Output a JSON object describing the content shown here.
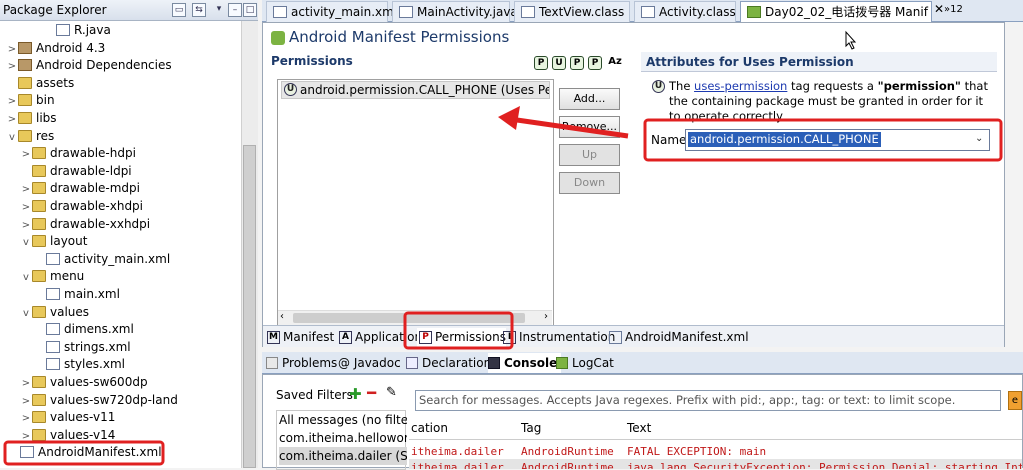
{
  "package_explorer": {
    "title": "Package Explorer",
    "items": [
      {
        "label": "R.java",
        "icon": "java-file-icon",
        "expand": ""
      },
      {
        "label": "Android 4.3",
        "icon": "library-icon",
        "expand": ">"
      },
      {
        "label": "Android Dependencies",
        "icon": "library-icon",
        "expand": ">"
      },
      {
        "label": "assets",
        "icon": "folder-icon",
        "expand": ""
      },
      {
        "label": "bin",
        "icon": "folder-icon",
        "expand": ">"
      },
      {
        "label": "libs",
        "icon": "folder-icon",
        "expand": ">"
      },
      {
        "label": "res",
        "icon": "folder-icon",
        "expand": "v"
      },
      {
        "label": "drawable-hdpi",
        "icon": "folder-icon",
        "expand": ">"
      },
      {
        "label": "drawable-ldpi",
        "icon": "folder-icon",
        "expand": ""
      },
      {
        "label": "drawable-mdpi",
        "icon": "folder-icon",
        "expand": ">"
      },
      {
        "label": "drawable-xhdpi",
        "icon": "folder-icon",
        "expand": ">"
      },
      {
        "label": "drawable-xxhdpi",
        "icon": "folder-icon",
        "expand": ">"
      },
      {
        "label": "layout",
        "icon": "folder-icon",
        "expand": "v"
      },
      {
        "label": "activity_main.xml",
        "icon": "xml-file-icon",
        "expand": ""
      },
      {
        "label": "menu",
        "icon": "folder-icon",
        "expand": "v"
      },
      {
        "label": "main.xml",
        "icon": "xml-file-icon",
        "expand": ""
      },
      {
        "label": "values",
        "icon": "folder-icon",
        "expand": "v"
      },
      {
        "label": "dimens.xml",
        "icon": "xml-file-icon",
        "expand": ""
      },
      {
        "label": "strings.xml",
        "icon": "xml-file-icon",
        "expand": ""
      },
      {
        "label": "styles.xml",
        "icon": "xml-file-icon",
        "expand": ""
      },
      {
        "label": "values-sw600dp",
        "icon": "folder-icon",
        "expand": ">"
      },
      {
        "label": "values-sw720dp-land",
        "icon": "folder-icon",
        "expand": ">"
      },
      {
        "label": "values-v11",
        "icon": "folder-icon",
        "expand": ">"
      },
      {
        "label": "values-v14",
        "icon": "folder-icon",
        "expand": ">"
      },
      {
        "label": "AndroidManifest.xml",
        "icon": "manifest-file-icon",
        "expand": ""
      }
    ]
  },
  "editor_tabs": [
    {
      "label": "activity_main.xml"
    },
    {
      "label": "MainActivity.java"
    },
    {
      "label": "TextView.class"
    },
    {
      "label": "Activity.class"
    },
    {
      "label": "Day02_02_电话拨号器 Manif"
    }
  ],
  "editor_tabs_overflow": "»12",
  "editor": {
    "title": "Android Manifest Permissions",
    "permissions_heading": "Permissions",
    "sort_icons": [
      "P",
      "U",
      "P",
      "P",
      "Az"
    ],
    "permission_item": "android.permission.CALL_PHONE (Uses Permis",
    "buttons": {
      "add": "Add...",
      "remove": "Remove...",
      "up": "Up",
      "down": "Down"
    },
    "attributes_heading": "Attributes for Uses Permission",
    "description_pre": "The ",
    "description_link": "uses-permission",
    "description_mid": " tag requests a ",
    "description_bold": "\"permission\"",
    "description_post": " that the containing package must be granted in order for it to operate correctly.",
    "name_label": "Name",
    "name_value": "android.permission.CALL_PHONE"
  },
  "bottom_tabs": [
    {
      "label": "Manifest",
      "icon": "M"
    },
    {
      "label": "Application",
      "icon": "A"
    },
    {
      "label": "Permissions",
      "icon": "P"
    },
    {
      "label": "Instrumentation",
      "icon": "I"
    },
    {
      "label": "AndroidManifest.xml",
      "icon": ""
    }
  ],
  "view_tabs": [
    {
      "label": "Problems"
    },
    {
      "label": "@ Javadoc"
    },
    {
      "label": "Declaration"
    },
    {
      "label": "Console"
    },
    {
      "label": "LogCat"
    }
  ],
  "logcat": {
    "saved_filters": "Saved Filters",
    "filters": [
      "All messages (no filters)",
      "com.itheima.helloworld",
      "com.itheima.dailer (Sess"
    ],
    "search_placeholder": "Search for messages. Accepts Java regexes. Prefix with pid:, app:, tag: or text: to limit scope.",
    "columns": [
      "cation",
      "Tag",
      "Text"
    ],
    "rows": [
      {
        "app": "itheima.dailer",
        "tag": "AndroidRuntime",
        "text": "FATAL EXCEPTION: main"
      },
      {
        "app": "itheima.dailer",
        "tag": "AndroidRuntime",
        "text": "java.lang.SecurityException: Permission Denial: starting Intent"
      }
    ]
  },
  "colors": {
    "annotation_red": "#e02020",
    "selection_blue": "#2b5fb8",
    "link_blue": "#1d3ab0",
    "log_error_red": "#c01818"
  }
}
